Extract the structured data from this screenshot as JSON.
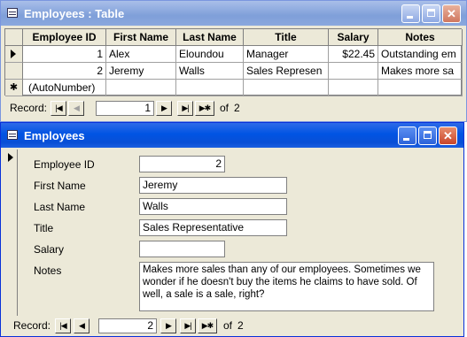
{
  "table_window": {
    "title": "Employees : Table",
    "columns": [
      "Employee ID",
      "First Name",
      "Last Name",
      "Title",
      "Salary",
      "Notes"
    ],
    "rows": [
      [
        "1",
        "Alex",
        "Eloundou",
        "Manager",
        "$22.45",
        "Outstanding em"
      ],
      [
        "2",
        "Jeremy",
        "Walls",
        "Sales Represen",
        "",
        "Makes more sa"
      ]
    ],
    "new_row": [
      "(AutoNumber)",
      "",
      "",
      "",
      "",
      ""
    ],
    "nav": {
      "record_label": "Record:",
      "current": "1",
      "of_label": "of",
      "total": "2"
    }
  },
  "form_window": {
    "title": "Employees",
    "fields": {
      "employee_id": {
        "label": "Employee ID",
        "value": "2"
      },
      "first_name": {
        "label": "First Name",
        "value": "Jeremy"
      },
      "last_name": {
        "label": "Last Name",
        "value": "Walls"
      },
      "title": {
        "label": "Title",
        "value": "Sales Representative"
      },
      "salary": {
        "label": "Salary",
        "value": ""
      },
      "notes": {
        "label": "Notes",
        "value": "Makes more sales than any of our employees. Sometimes we wonder if he doesn't buy the items he claims to have sold. Of well, a sale is a sale, right?"
      }
    },
    "nav": {
      "record_label": "Record:",
      "current": "2",
      "of_label": "of",
      "total": "2"
    }
  },
  "colors": {
    "active_title": "#0054e3",
    "inactive_title": "#7f9fd9",
    "chrome": "#ece9d8"
  }
}
